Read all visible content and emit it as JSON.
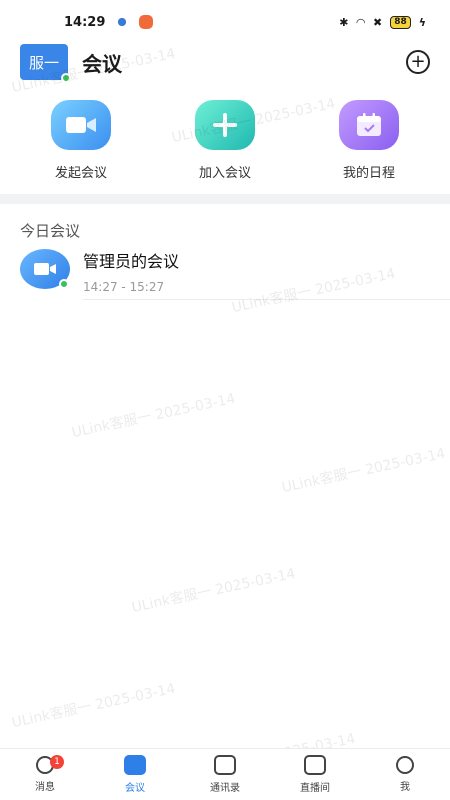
{
  "status_bar": {
    "time": "14:29",
    "battery": "88"
  },
  "header": {
    "avatar_text": "服一",
    "title": "会议"
  },
  "actions": [
    {
      "label": "发起会议",
      "icon": "video-camera-icon",
      "color": "#3b8ff0"
    },
    {
      "label": "加入会议",
      "icon": "plus-icon",
      "color": "#1fb8b0"
    },
    {
      "label": "我的日程",
      "icon": "calendar-icon",
      "color": "#8a5ff0"
    }
  ],
  "today": {
    "section_title": "今日会议",
    "meetings": [
      {
        "title": "管理员的会议",
        "time": "14:27 - 15:27"
      }
    ]
  },
  "watermark": "ULink客服一 2025-03-14",
  "tab_bar": {
    "items": [
      {
        "label": "消息",
        "icon": "message-icon",
        "badge": "1"
      },
      {
        "label": "会议",
        "icon": "meeting-icon",
        "active": true
      },
      {
        "label": "通讯录",
        "icon": "contacts-icon"
      },
      {
        "label": "直播间",
        "icon": "tv-icon"
      },
      {
        "label": "我",
        "icon": "person-icon"
      }
    ]
  },
  "colors": {
    "accent": "#2e7fe8",
    "online": "#39c159",
    "badge": "#f44336"
  }
}
